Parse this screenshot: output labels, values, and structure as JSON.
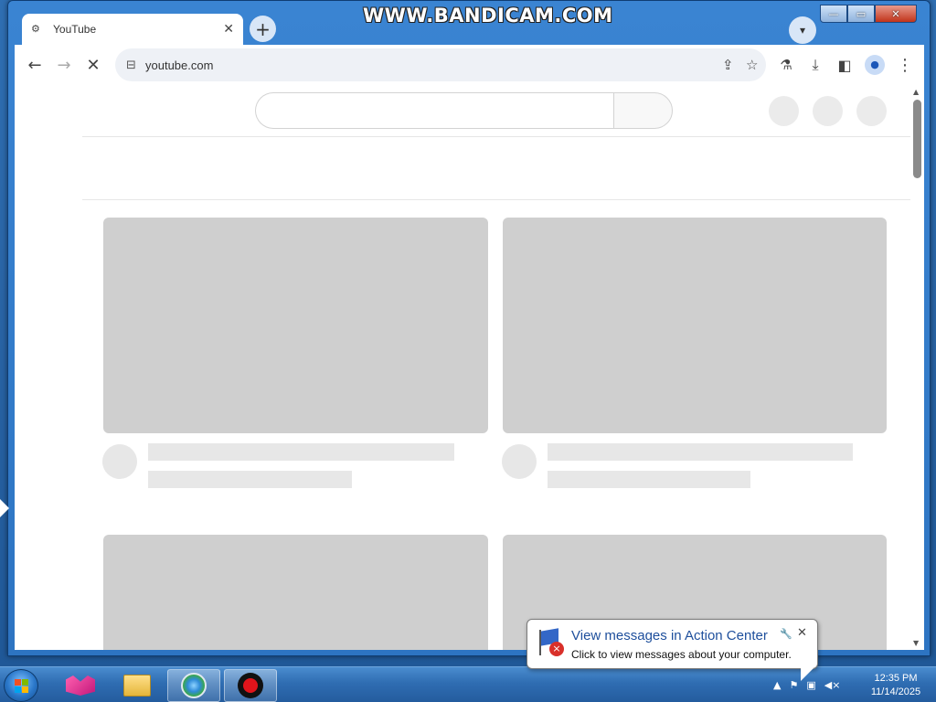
{
  "watermark": "WWW.BANDICAM.COM",
  "window_controls": {
    "minimize": "—",
    "maximize": "▭",
    "close": "✕"
  },
  "browser": {
    "tab": {
      "title": "YouTube",
      "favicon": "tune-icon",
      "close": "✕"
    },
    "new_tab": "+",
    "tab_search": "▾",
    "toolbar": {
      "back": "←",
      "forward": "→",
      "stop": "✕",
      "url": "youtube.com",
      "site_info_icon": "⊟",
      "share_icon": "⇪",
      "bookmark_icon": "☆",
      "labs_icon": "⚗",
      "download_icon": "⤓",
      "sidepanel_icon": "◧",
      "profile_icon": "●",
      "menu_icon": "⋮"
    }
  },
  "page": {
    "site": "YouTube",
    "state": "loading-skeleton"
  },
  "scrollbar": {
    "up": "▲",
    "down": "▼"
  },
  "taskbar": {
    "apps": [
      "app-1",
      "file-explorer",
      "browser",
      "bandicam-record"
    ],
    "clock_time": "12:35 PM",
    "clock_date": "11/14/2025",
    "tray_show_hidden": "▲"
  },
  "notification": {
    "title": "View messages in Action Center",
    "text": "Click to view messages about your computer.",
    "close": "✕",
    "options": "🔧"
  },
  "colors": {
    "accent": "#1a73e8",
    "skeleton_thumb": "#cfcfcf",
    "skeleton_line": "#e7e7e7",
    "taskbar": "#2f6db2"
  }
}
